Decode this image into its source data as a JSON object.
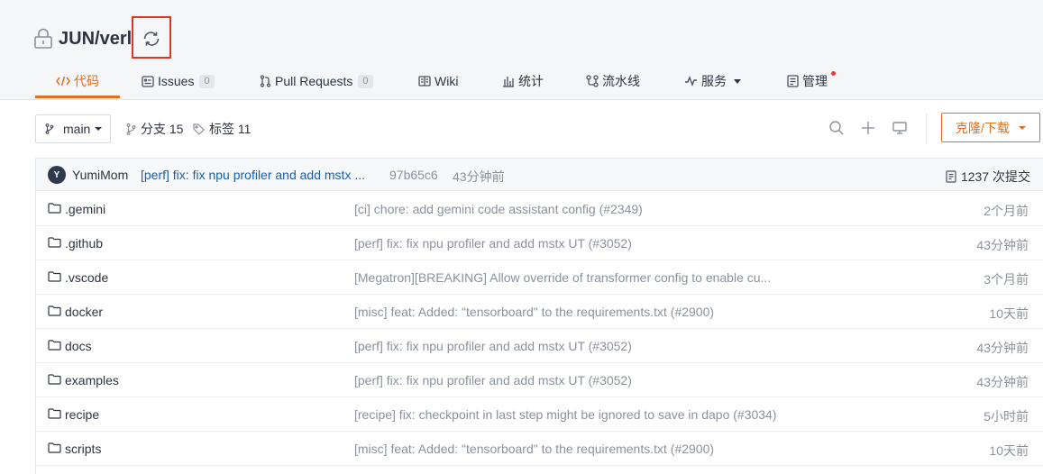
{
  "repo": {
    "title": "JUN/verl"
  },
  "tabs": [
    {
      "label": "代码"
    },
    {
      "label": "Issues",
      "count": "0"
    },
    {
      "label": "Pull Requests",
      "count": "0"
    },
    {
      "label": "Wiki"
    },
    {
      "label": "统计"
    },
    {
      "label": "流水线"
    },
    {
      "label": "服务"
    },
    {
      "label": "管理"
    }
  ],
  "toolbar": {
    "branch": "main",
    "branches_label": "分支 15",
    "tags_label": "标签 11",
    "clone_label": "克隆/下载"
  },
  "latest_commit": {
    "avatar_letter": "Y",
    "author": "YumiMom",
    "message": "[perf] fix: fix npu profiler and add mstx ...",
    "hash": "97b65c6",
    "time": "43分钟前",
    "count_label": "1237 次提交"
  },
  "files": [
    {
      "name": ".gemini",
      "message": "[ci] chore: add gemini code assistant config (#2349)",
      "time": "2个月前"
    },
    {
      "name": ".github",
      "message": "[perf] fix: fix npu profiler and add mstx UT (#3052)",
      "time": "43分钟前"
    },
    {
      "name": ".vscode",
      "message": "[Megatron][BREAKING] Allow override of transformer config to enable cu...",
      "time": "3个月前"
    },
    {
      "name": "docker",
      "message": "[misc] feat: Added: \"tensorboard\" to the requirements.txt (#2900)",
      "time": "10天前"
    },
    {
      "name": "docs",
      "message": "[perf] fix: fix npu profiler and add mstx UT (#3052)",
      "time": "43分钟前"
    },
    {
      "name": "examples",
      "message": "[perf] fix: fix npu profiler and add mstx UT (#3052)",
      "time": "43分钟前"
    },
    {
      "name": "recipe",
      "message": "[recipe] fix: checkpoint in last step might be ignored to save in dapo (#3034)",
      "time": "5小时前"
    },
    {
      "name": "scripts",
      "message": "[misc] feat: Added: \"tensorboard\" to the requirements.txt (#2900)",
      "time": "10天前"
    }
  ],
  "colors": {
    "accent": "#e0701f",
    "link": "#1a5fa6",
    "highlight_box": "#d9382b"
  },
  "icons": [
    "lock-icon",
    "sync-icon",
    "code-icon",
    "issues-icon",
    "pull-request-icon",
    "wiki-icon",
    "stats-icon",
    "pipeline-icon",
    "services-icon",
    "manage-icon",
    "branch-icon",
    "tag-icon",
    "search-icon",
    "plus-icon",
    "monitor-icon",
    "folder-icon",
    "commits-icon"
  ]
}
